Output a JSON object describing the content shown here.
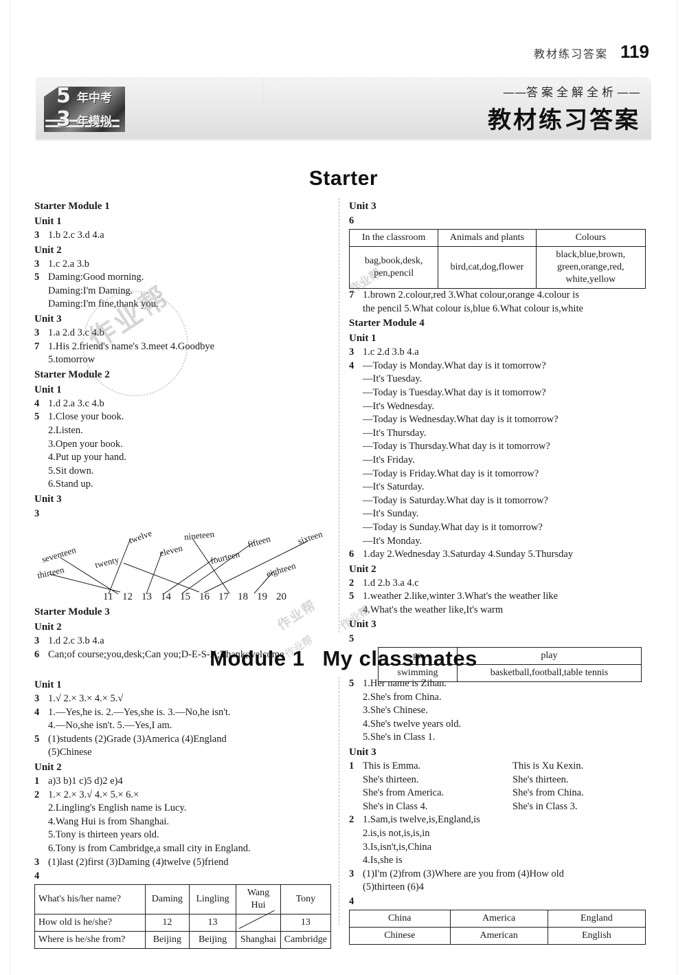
{
  "header": {
    "running_title": "教材练习答案",
    "page_number": "119",
    "banner_subtitle": "答案全解全析",
    "banner_title": "教材练习答案",
    "logo": {
      "five": "5",
      "three": "3",
      "cn_top": "年中考",
      "cn_bottom": "年模拟"
    }
  },
  "watermarks": {
    "w1": "作业帮",
    "w2": "作业帮",
    "w3": "作业帮",
    "w4": "作业帮",
    "w5": "作业帮"
  },
  "sections": {
    "starter_heading": "Starter",
    "module1_heading": "Module 1",
    "module1_subheading": "My classmates"
  },
  "left_col_top": {
    "sm1_title": "Starter Module 1",
    "u1_title": "Unit 1",
    "u1_q3_num": "3",
    "u1_q3": "1.b   2.c   3.d   4.a",
    "u2_title": "Unit 2",
    "u2_q3_num": "3",
    "u2_q3": "1.c   2.a   3.b",
    "u2_q5_num": "5",
    "u2_q5_l1": "Daming:Good morning.",
    "u2_q5_l2": "Daming:I'm Daming.",
    "u2_q5_l3": "Daming:I'm fine,thank you.",
    "u3_title": "Unit 3",
    "u3_q3_num": "3",
    "u3_q3": "1.a   2.d   3.c   4.b",
    "u3_q7_num": "7",
    "u3_q7_l1": "1.His   2.friend's name's   3.meet   4.Goodbye",
    "u3_q7_l2": "5.tomorrow",
    "sm2_title": "Starter Module 2",
    "sm2_u1_title": "Unit 1",
    "sm2_u1_q4_num": "4",
    "sm2_u1_q4": "1.d   2.a   3.c   4.b",
    "sm2_u1_q5_num": "5",
    "sm2_u1_q5": [
      "1.Close your book.",
      "2.Listen.",
      "3.Open your book.",
      "4.Put up your hand.",
      "5.Sit down.",
      "6.Stand up."
    ],
    "sm2_u3_title": "Unit 3",
    "sm2_u3_q3_num": "3",
    "match_words": [
      "seventeen",
      "twenty",
      "twelve",
      "eleven",
      "nineteen",
      "fourteen",
      "fifteen",
      "eighteen",
      "sixteen",
      "thirteen"
    ],
    "match_numbers": [
      "11",
      "12",
      "13",
      "14",
      "15",
      "16",
      "17",
      "18",
      "19",
      "20"
    ],
    "sm3_title": "Starter Module 3",
    "sm3_u2_title": "Unit 2",
    "sm3_u2_q3_num": "3",
    "sm3_u2_q3": "1.d   2.c   3.b   4.a",
    "sm3_u2_q6_num": "6",
    "sm3_u2_q6": "Can;of course;you,desk;Can you;D-E-S-K;Thank;welcome"
  },
  "right_col_top": {
    "u3_title": "Unit 3",
    "q6_num": "6",
    "table6": {
      "headers": [
        "In the classroom",
        "Animals and plants",
        "Colours"
      ],
      "row": [
        "bag,book,desk,\npen,pencil",
        "bird,cat,dog,flower",
        "black,blue,brown,\ngreen,orange,red,\nwhite,yellow"
      ]
    },
    "q7_num": "7",
    "q7_l1": "1.brown    2.colour,red    3.What colour,orange    4.colour is",
    "q7_l2": "the pencil   5.What colour is,blue   6.What colour is,white",
    "sm4_title": "Starter Module 4",
    "sm4_u1_title": "Unit 1",
    "sm4_u1_q3_num": "3",
    "sm4_u1_q3": "1.c   2.d   3.b   4.a",
    "sm4_u1_q4_num": "4",
    "sm4_u1_q4": [
      "—Today is Monday.What day is it tomorrow?",
      "—It's Tuesday.",
      "—Today is Tuesday.What day is it tomorrow?",
      "—It's Wednesday.",
      "—Today is Wednesday.What day is it tomorrow?",
      "—It's Thursday.",
      "—Today is Thursday.What day is it tomorrow?",
      "—It's Friday.",
      "—Today is Friday.What day is it tomorrow?",
      "—It's Saturday.",
      "—Today is Saturday.What day is it tomorrow?",
      "—It's Sunday.",
      "—Today is Sunday.What day is it tomorrow?",
      "—It's Monday."
    ],
    "sm4_u1_q6_num": "6",
    "sm4_u1_q6": "1.day  2.Wednesday  3.Saturday  4.Sunday  5.Thursday",
    "sm4_u2_title": "Unit 2",
    "sm4_u2_q2_num": "2",
    "sm4_u2_q2": "1.d   2.b   3.a   4.c",
    "sm4_u2_q5_num": "5",
    "sm4_u2_q5_l1": "1.weather   2.like,winter   3.What's the weather like",
    "sm4_u2_q5_l2": "4.What's the weather like,It's warm",
    "sm4_u3_title": "Unit 3",
    "sm4_u3_q5_num": "5",
    "table5": {
      "headers": [
        "go",
        "play"
      ],
      "row": [
        "swimming",
        "basketball,football,table tennis"
      ]
    }
  },
  "left_col_bottom": {
    "u1_title": "Unit 1",
    "q3_num": "3",
    "q3": "1.√   2.×   3.×   4.×   5.√",
    "q4_num": "4",
    "q4_l1": "1.—Yes,he is.   2.—Yes,she is.   3.—No,he isn't.",
    "q4_l2": "4.—No,she isn't.   5.—Yes,I am.",
    "q5_num": "5",
    "q5_l1": "(1)students   (2)Grade   (3)America   (4)England",
    "q5_l2": "(5)Chinese",
    "u2_title": "Unit 2",
    "u2_q1_num": "1",
    "u2_q1": "a)3   b)1   c)5   d)2   e)4",
    "u2_q2_num": "2",
    "u2_q2_l1": "1.×  2.×  3.√   4.×  5.×  6.×",
    "u2_q2_l2": "2.Lingling's English name is Lucy.",
    "u2_q2_l3": "4.Wang Hui is from Shanghai.",
    "u2_q2_l4": "5.Tony is thirteen years old.",
    "u2_q2_l5": "6.Tony is from Cambridge,a small city in England.",
    "u2_q3_num": "3",
    "u2_q3": "(1)last   (2)first   (3)Daming   (4)twelve   (5)friend",
    "u2_q4_num": "4",
    "table4": {
      "rows": [
        [
          "What's his/her name?",
          "Daming",
          "Lingling",
          "Wang Hui",
          "Tony"
        ],
        [
          "How old is he/she?",
          "12",
          "13",
          "",
          "13"
        ],
        [
          "Where is he/she from?",
          "Beijing",
          "Beijing",
          "Shanghai",
          "Cambridge"
        ]
      ]
    }
  },
  "right_col_bottom": {
    "q5_num": "5",
    "q5": [
      "1.Her name is Zihan.",
      "2.She's from China.",
      "3.She's Chinese.",
      "4.She's twelve years old.",
      "5.She's in Class 1."
    ],
    "u3_title": "Unit 3",
    "u3_q1_num": "1",
    "u3_q1_left": [
      "This is Emma.",
      "She's thirteen.",
      "She's from America.",
      "She's in Class 4."
    ],
    "u3_q1_right": [
      "This is Xu Kexin.",
      "She's thirteen.",
      "She's from China.",
      "She's in Class 3."
    ],
    "u3_q2_num": "2",
    "u3_q2": [
      "1.Sam,is twelve,is,England,is",
      "2.is,is not,is,is,in",
      "3.Is,isn't,is,China",
      "4.Is,she is"
    ],
    "u3_q3_num": "3",
    "u3_q3_l1": "(1)I'm   (2)from   (3)Where are you from   (4)How old",
    "u3_q3_l2": "(5)thirteen   (6)4",
    "u3_q4_num": "4",
    "table4": {
      "rows": [
        [
          "China",
          "America",
          "England"
        ],
        [
          "Chinese",
          "American",
          "English"
        ]
      ]
    }
  }
}
